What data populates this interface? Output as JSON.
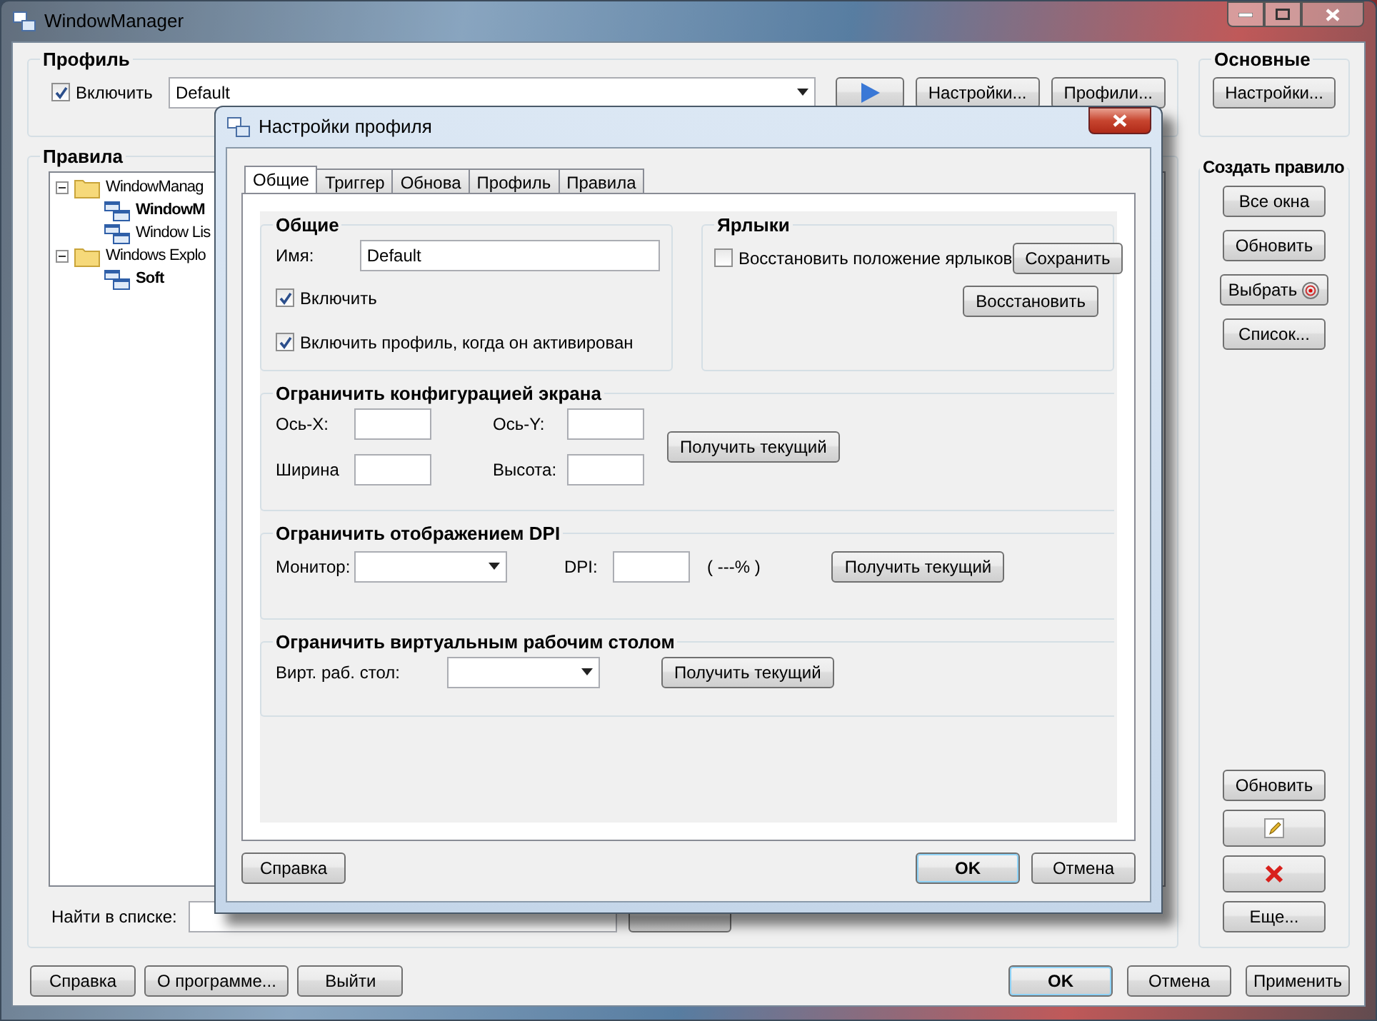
{
  "main_window": {
    "title": "WindowManager"
  },
  "profile_group": {
    "title": "Профиль",
    "enable": {
      "label": "Включить",
      "checked": true
    },
    "profile_combo": {
      "value": "Default"
    },
    "buttons": [
      "Настройки...",
      "Профили..."
    ]
  },
  "basic_group": {
    "title": "Основные",
    "buttons": [
      "Настройки..."
    ]
  },
  "rules_group": {
    "title": "Правила",
    "tree": [
      {
        "label": "WindowManag",
        "bold": false,
        "kind": "folder",
        "expanded": true,
        "children": [
          {
            "label": "WindowM",
            "bold": true,
            "kind": "rule"
          },
          {
            "label": "Window Lis",
            "bold": false,
            "kind": "rule"
          }
        ]
      },
      {
        "label": "Windows Explo",
        "bold": false,
        "kind": "folder",
        "expanded": true,
        "children": [
          {
            "label": "Soft",
            "bold": true,
            "kind": "rule"
          }
        ]
      }
    ],
    "search_label": "Найти в списке:"
  },
  "create_rule_group": {
    "title": "Создать правило",
    "buttons": [
      {
        "kind": "text",
        "label": "Все окна"
      },
      {
        "kind": "text",
        "label": "Обновить"
      },
      {
        "kind": "target",
        "label": "Выбрать"
      },
      {
        "kind": "text",
        "label": "Список..."
      }
    ],
    "lower_buttons": [
      {
        "kind": "text",
        "label": "Обновить"
      },
      {
        "kind": "edit"
      },
      {
        "kind": "delete"
      },
      {
        "kind": "text",
        "label": "Еще..."
      }
    ]
  },
  "footer_left": [
    "Справка",
    "О программе...",
    "Выйти"
  ],
  "footer_right": [
    {
      "label": "OK",
      "default": true
    },
    {
      "label": "Отмена",
      "default": false
    },
    {
      "label": "Применить",
      "default": false
    }
  ],
  "dialog": {
    "title": "Настройки профиля",
    "tabs": [
      {
        "label": "Общие",
        "selected": true
      },
      {
        "label": "Триггер",
        "selected": false
      },
      {
        "label": "Обнова",
        "selected": false
      },
      {
        "label": "Профиль",
        "selected": false
      },
      {
        "label": "Правила",
        "selected": false
      }
    ],
    "general": {
      "title": "Общие",
      "name_label": "Имя:",
      "name_value": "Default",
      "checkboxes": [
        {
          "label": "Включить",
          "checked": true
        },
        {
          "label": "Включить профиль, когда он активирован",
          "checked": true
        }
      ]
    },
    "shortcuts": {
      "title": "Ярлыки",
      "checkbox": {
        "label": "Восстановить положение ярлыков",
        "checked": false
      },
      "buttons": [
        "Сохранить",
        "Восстановить"
      ]
    },
    "screen": {
      "title": "Ограничить конфигурацией экрана",
      "fields": [
        {
          "label": "Ось-X:"
        },
        {
          "label": "Ось-Y:"
        },
        {
          "label": "Ширина"
        },
        {
          "label": "Высота:"
        }
      ],
      "button": "Получить текущий"
    },
    "dpi": {
      "title": "Ограничить отображением DPI",
      "monitor_label": "Монитор:",
      "dpi_label": "DPI:",
      "percent": "( ---% )",
      "button": "Получить текущий"
    },
    "desktop": {
      "title": "Ограничить виртуальным рабочим столом",
      "label": "Вирт. раб. стол:",
      "button": "Получить текущий"
    },
    "footer_left": "Справка",
    "footer_right": [
      {
        "label": "OK",
        "default": true
      },
      {
        "label": "Отмена",
        "default": false
      }
    ]
  }
}
